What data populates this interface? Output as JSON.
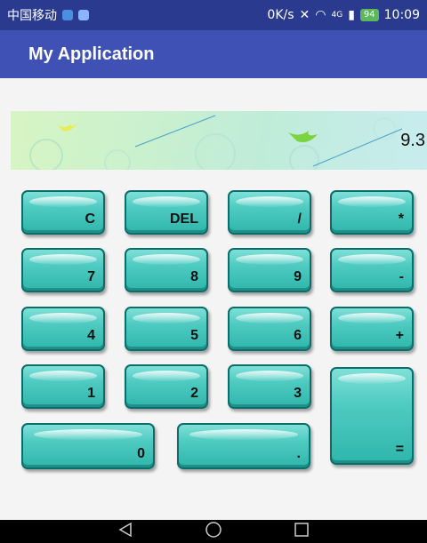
{
  "status_bar": {
    "carrier": "中国移动",
    "speed": "0K/s",
    "network": "4G",
    "battery": "94",
    "time": "10:09"
  },
  "app_bar": {
    "title": "My Application"
  },
  "display": {
    "value": "9.3"
  },
  "keys": {
    "clear": "C",
    "delete": "DEL",
    "divide": "/",
    "multiply": "*",
    "seven": "7",
    "eight": "8",
    "nine": "9",
    "minus": "-",
    "four": "4",
    "five": "5",
    "six": "6",
    "plus": "+",
    "one": "1",
    "two": "2",
    "three": "3",
    "equals": "=",
    "zero": "0",
    "dot": "."
  },
  "nav_bar": {
    "back_icon": "back-icon",
    "home_icon": "home-icon",
    "recents_icon": "recents-icon"
  },
  "colors": {
    "status_bar": "#2a3b8f",
    "app_bar": "#3f51b5",
    "key": "#3fc4bb"
  }
}
